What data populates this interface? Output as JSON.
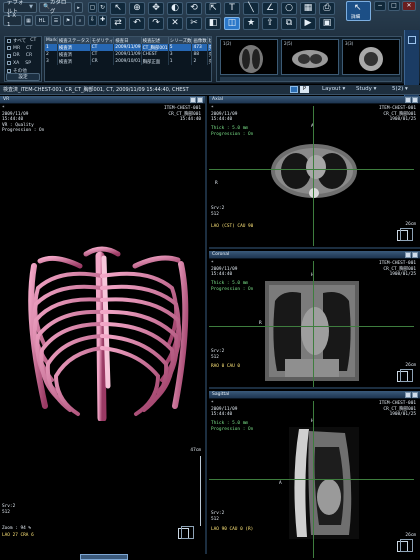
{
  "toolbar": {
    "preset_label": "デフォルト",
    "layout_select": "1 X 1",
    "hl_label": "HL",
    "patient_search_label": "カタログ",
    "detail_label": "詳細",
    "settings_label": "設定",
    "tool_icons": [
      "arrow-pointer-icon",
      "zoom-icon",
      "pan-icon",
      "window-level-icon",
      "rotate-icon",
      "cursor-icon",
      "text-annotation-icon",
      "line-measure-icon",
      "angle-icon",
      "roi-icon",
      "grid-layout-icon",
      "print-icon",
      "sync-icon",
      "undo-icon",
      "redo-icon",
      "delete-icon",
      "cut-icon",
      "mask-icon",
      "mpr-icon",
      "key-image-icon",
      "export-icon",
      "compare-icon",
      "cine-icon",
      "save-icon"
    ]
  },
  "filter": {
    "items": [
      {
        "label": "すべて",
        "extra": "CT"
      },
      {
        "label": "MR",
        "extra": "CT"
      },
      {
        "label": "DR",
        "extra": "CR"
      },
      {
        "label": "XA",
        "extra": "SP"
      },
      {
        "label": "その他",
        "extra": ""
      },
      {
        "label": "表示しない",
        "extra": ""
      }
    ],
    "settings": "設定"
  },
  "study_table": {
    "headers": [
      "Mark",
      "検査ステータス",
      "モダリティ",
      "検査日",
      "検査記述",
      "シリーズ数",
      "画像数",
      "状態"
    ],
    "rows": [
      {
        "mark": "1",
        "status": "検査済",
        "modality": "CT",
        "date": "2009/11/09",
        "desc": "CT_胸部001",
        "series": "5",
        "images": "473",
        "state": "完"
      },
      {
        "mark": "2",
        "status": "検査済",
        "modality": "CT",
        "date": "2009/11/09",
        "desc": "CHEST",
        "series": "3",
        "images": "88",
        "state": "完"
      },
      {
        "mark": "3",
        "status": "検査済",
        "modality": "CR",
        "date": "2009/10/01",
        "desc": "胸部正面",
        "series": "1",
        "images": "2",
        "state": "完"
      }
    ]
  },
  "thumbnails": [
    {
      "label": "1(2)"
    },
    {
      "label": "2(5)"
    },
    {
      "label": "3(3)"
    }
  ],
  "statusbar": {
    "patient_line": "検査済_ITEM-CHEST-001, CR_CT_胸部001, CT, 2009/11/09 15:44:40, CHEST",
    "layout_label": "Layout",
    "study_label": "Study",
    "page_label": "5(2)",
    "p_button": "P"
  },
  "vr_pane": {
    "title": "VR",
    "top_left": "*\n2009/11/09\n15:44:40\nVR : Quality\nProgression : On",
    "top_right": "ITEM-CHEST-001\nCR_CT_胸部001\n15:44:40",
    "bottom_left": "Srv:2\n512",
    "zoom": "Zoom : 94 %",
    "orient": "LAO 27 CRA 6",
    "scale": "47cm"
  },
  "axial_pane": {
    "title": "Axial",
    "top_left": "*\n2009/11/09\n15:44:40",
    "top_right": "ITEM-CHEST-001\nCR_CT_胸部001\n1908/01/25",
    "thick": "Thick : 5.0 mm\nProgression : On",
    "bottom_left": "Srv:2\n512",
    "orient": "LAO (CST) CAU 90",
    "scale": "26cm",
    "anterior": "A",
    "right": "R"
  },
  "coronal_pane": {
    "title": "Coronal",
    "top_left": "*\n2009/11/09\n15:44:40",
    "top_right": "ITEM-CHEST-001\nCR_CT_胸部001\n1908/01/25",
    "thick": "Thick : 5.0 mm\nProgression : On",
    "bottom_left": "Srv:2\n512",
    "orient": "RAO 0 CAU 0",
    "scale": "26cm",
    "head": "H",
    "right": "R"
  },
  "sagittal_pane": {
    "title": "Sagittal",
    "top_left": "*\n2009/11/09\n15:44:40",
    "top_right": "ITEM-CHEST-001\nCR_CT_胸部001\n1908/01/25",
    "thick": "Thick : 5.0 mm\nProgression : On",
    "bottom_left": "Srv:2\n512",
    "orient": "LAO 90 CAU 0 (R)",
    "scale": "26cm",
    "head": "H",
    "anterior": "A"
  },
  "colors": {
    "accent": "#2c78c9",
    "vr_tissue": "#d86c9b",
    "crosshair": "#3e7d3e",
    "overlay_yellow": "#ffe67a"
  }
}
